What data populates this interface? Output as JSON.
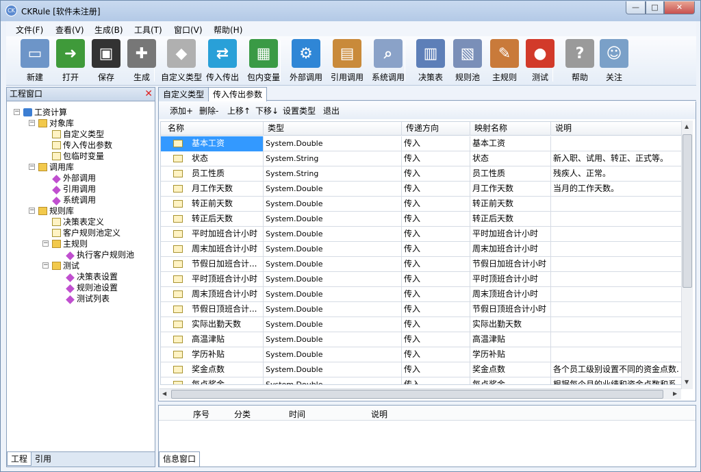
{
  "window": {
    "title": "CKRule [软件未注册]",
    "controls": {
      "minimize": "—",
      "maximize": "□",
      "close": "✕"
    }
  },
  "menu": [
    "文件(F)",
    "查看(V)",
    "生成(B)",
    "工具(T)",
    "窗口(V)",
    "帮助(H)"
  ],
  "toolbar": [
    {
      "label": "新建",
      "icon": "new-document-icon",
      "color": "#6d95c8"
    },
    {
      "label": "打开",
      "icon": "open-arrow-icon",
      "color": "#3f9a3a"
    },
    {
      "label": "保存",
      "icon": "floppy-disk-icon",
      "color": "#333333"
    },
    {
      "label": "生成",
      "icon": "wrench-screwdriver-icon",
      "color": "#777777"
    },
    {
      "label": "自定义类型",
      "icon": "custom-type-icon",
      "color": "#b0b0b0"
    },
    {
      "label": "传入传出",
      "icon": "arrows-exchange-icon",
      "color": "#29a0d8"
    },
    {
      "label": "包内变量",
      "icon": "package-icon",
      "color": "#3a9a45"
    },
    {
      "label": "外部调用",
      "icon": "gear-icon",
      "color": "#2f86d6"
    },
    {
      "label": "引用调用",
      "icon": "box-arrow-icon",
      "color": "#c98a3a"
    },
    {
      "label": "系统调用",
      "icon": "magnifier-icon",
      "color": "#8aa2c8"
    },
    {
      "label": "决策表",
      "icon": "decision-table-icon",
      "color": "#5d7fb8"
    },
    {
      "label": "规则池",
      "icon": "rule-pool-icon",
      "color": "#7a8fb8"
    },
    {
      "label": "主规则",
      "icon": "main-rule-icon",
      "color": "#c97a3a"
    },
    {
      "label": "测试",
      "icon": "ladybug-icon",
      "color": "#d23a2a"
    },
    {
      "label": "帮助",
      "icon": "help-question-icon",
      "color": "#9a9a9a"
    },
    {
      "label": "关注",
      "icon": "user-follow-icon",
      "color": "#7aa0c8"
    }
  ],
  "left_panel": {
    "title": "工程窗口",
    "tree": [
      {
        "label": "工资计算",
        "level": 0,
        "icon": "root",
        "exp": "−"
      },
      {
        "label": "对象库",
        "level": 1,
        "icon": "folder",
        "exp": "−"
      },
      {
        "label": "自定义类型",
        "level": 2,
        "icon": "doc"
      },
      {
        "label": "传入传出参数",
        "level": 2,
        "icon": "doc"
      },
      {
        "label": "包临时变量",
        "level": 2,
        "icon": "doc"
      },
      {
        "label": "调用库",
        "level": 1,
        "icon": "folder",
        "exp": "−"
      },
      {
        "label": "外部调用",
        "level": 2,
        "icon": "gem"
      },
      {
        "label": "引用调用",
        "level": 2,
        "icon": "gem"
      },
      {
        "label": "系统调用",
        "level": 2,
        "icon": "gem"
      },
      {
        "label": "规则库",
        "level": 1,
        "icon": "folder",
        "exp": "−"
      },
      {
        "label": "决策表定义",
        "level": 2,
        "icon": "doc"
      },
      {
        "label": "客户规则池定义",
        "level": 2,
        "icon": "doc"
      },
      {
        "label": "主规则",
        "level": 2,
        "icon": "folder",
        "exp": "−"
      },
      {
        "label": "执行客户规则池",
        "level": 3,
        "icon": "gem"
      },
      {
        "label": "测试",
        "level": 2,
        "icon": "folder",
        "exp": "−"
      },
      {
        "label": "决策表设置",
        "level": 3,
        "icon": "gem"
      },
      {
        "label": "规则池设置",
        "level": 3,
        "icon": "gem"
      },
      {
        "label": "测试列表",
        "level": 3,
        "icon": "gem"
      }
    ],
    "tabs": [
      "工程",
      "引用"
    ]
  },
  "doc_tabs": [
    "自定义类型",
    "传入传出参数"
  ],
  "subtoolbar": [
    "添加+",
    "删除-",
    "上移↑",
    "下移↓",
    "设置类型",
    "退出"
  ],
  "grid": {
    "columns": [
      "名称",
      "类型",
      "传递方向",
      "映射名称",
      "说明"
    ],
    "rows": [
      [
        "基本工资",
        "System.Double",
        "传入",
        "基本工资",
        ""
      ],
      [
        "状态",
        "System.String",
        "传入",
        "状态",
        "新入职、试用、转正、正式等。"
      ],
      [
        "员工性质",
        "System.String",
        "传入",
        "员工性质",
        "残疾人、正常。"
      ],
      [
        "月工作天数",
        "System.Double",
        "传入",
        "月工作天数",
        "当月的工作天数。"
      ],
      [
        "转正前天数",
        "System.Double",
        "传入",
        "转正前天数",
        ""
      ],
      [
        "转正后天数",
        "System.Double",
        "传入",
        "转正后天数",
        ""
      ],
      [
        "平时加班合计小时",
        "System.Double",
        "传入",
        "平时加班合计小时",
        ""
      ],
      [
        "周末加班合计小时",
        "System.Double",
        "传入",
        "周末加班合计小时",
        ""
      ],
      [
        "节假日加班合计...",
        "System.Double",
        "传入",
        "节假日加班合计小时",
        ""
      ],
      [
        "平时顶班合计小时",
        "System.Double",
        "传入",
        "平时顶班合计小时",
        ""
      ],
      [
        "周末顶班合计小时",
        "System.Double",
        "传入",
        "周末顶班合计小时",
        ""
      ],
      [
        "节假日顶班合计...",
        "System.Double",
        "传入",
        "节假日顶班合计小时",
        ""
      ],
      [
        "实际出勤天数",
        "System.Double",
        "传入",
        "实际出勤天数",
        ""
      ],
      [
        "高温津贴",
        "System.Double",
        "传入",
        "高温津贴",
        ""
      ],
      [
        "学历补贴",
        "System.Double",
        "传入",
        "学历补贴",
        ""
      ],
      [
        "奖金点数",
        "System.Double",
        "传入",
        "奖金点数",
        "各个员工级别设置不同的资金点数."
      ],
      [
        "每点奖金",
        "System.Double",
        "传入",
        "每点奖金",
        "根据每个月的业绩和资金点数和系"
      ]
    ]
  },
  "info_panel": {
    "columns": [
      "序号",
      "分类",
      "时间",
      "说明"
    ],
    "tab": "信息窗口"
  }
}
